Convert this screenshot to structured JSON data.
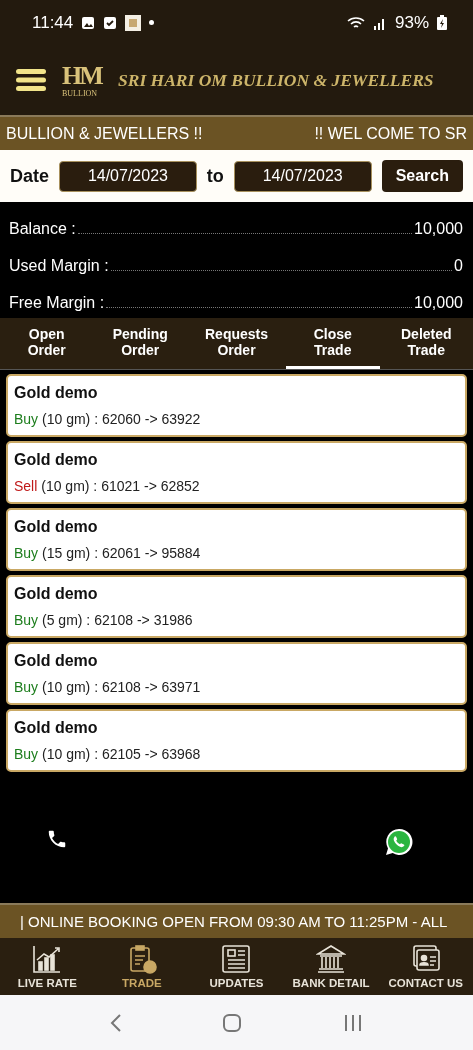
{
  "status_bar": {
    "time": "11:44",
    "battery": "93%"
  },
  "header": {
    "logo_mark": "HM",
    "logo_sub": "BULLION",
    "title": "SRI HARI OM BULLION & JEWELLERS"
  },
  "top_ticker": [
    "BULLION & JEWELLERS !!",
    "!! WEL COME TO SR"
  ],
  "date_filter": {
    "label": "Date",
    "from": "14/07/2023",
    "separator": "to",
    "to": "14/07/2023",
    "button": "Search"
  },
  "account": [
    {
      "label": "Balance :",
      "value": "10,000"
    },
    {
      "label": "Used Margin :",
      "value": "0"
    },
    {
      "label": "Free Margin :",
      "value": "10,000"
    }
  ],
  "tabs": [
    {
      "label": "Open Order",
      "selected": false
    },
    {
      "label": "Pending Order",
      "selected": false
    },
    {
      "label": "Requests Order",
      "selected": false
    },
    {
      "label": "Close Trade",
      "selected": true
    },
    {
      "label": "Deleted Trade",
      "selected": false
    }
  ],
  "trades": [
    {
      "name": "Gold demo",
      "kind": "buy",
      "side": "Buy",
      "detail": " (10 gm) : 62060 -> 63922"
    },
    {
      "name": "Gold demo",
      "kind": "sell",
      "side": "Sell",
      "detail": " (10 gm) : 61021 -> 62852"
    },
    {
      "name": "Gold demo",
      "kind": "buy",
      "side": "Buy",
      "detail": " (15 gm) : 62061 -> 95884"
    },
    {
      "name": "Gold demo",
      "kind": "buy",
      "side": "Buy",
      "detail": " (5 gm) : 62108 -> 31986"
    },
    {
      "name": "Gold demo",
      "kind": "buy",
      "side": "Buy",
      "detail": " (10 gm) : 62108 -> 63971"
    },
    {
      "name": "Gold demo",
      "kind": "buy",
      "side": "Buy",
      "detail": " (10 gm) : 62105 -> 63968"
    }
  ],
  "bottom_ticker": "| ONLINE BOOKING OPEN FROM 09:30 AM TO 11:25PM - ALL",
  "bottom_nav": [
    {
      "kind": "chart",
      "label": "LIVE RATE",
      "selected": false
    },
    {
      "kind": "trade",
      "label": "TRADE",
      "selected": true
    },
    {
      "kind": "news",
      "label": "UPDATES",
      "selected": false
    },
    {
      "kind": "bank",
      "label": "BANK DETAIL",
      "selected": false
    },
    {
      "kind": "contact",
      "label": "CONTACT US",
      "selected": false
    }
  ]
}
